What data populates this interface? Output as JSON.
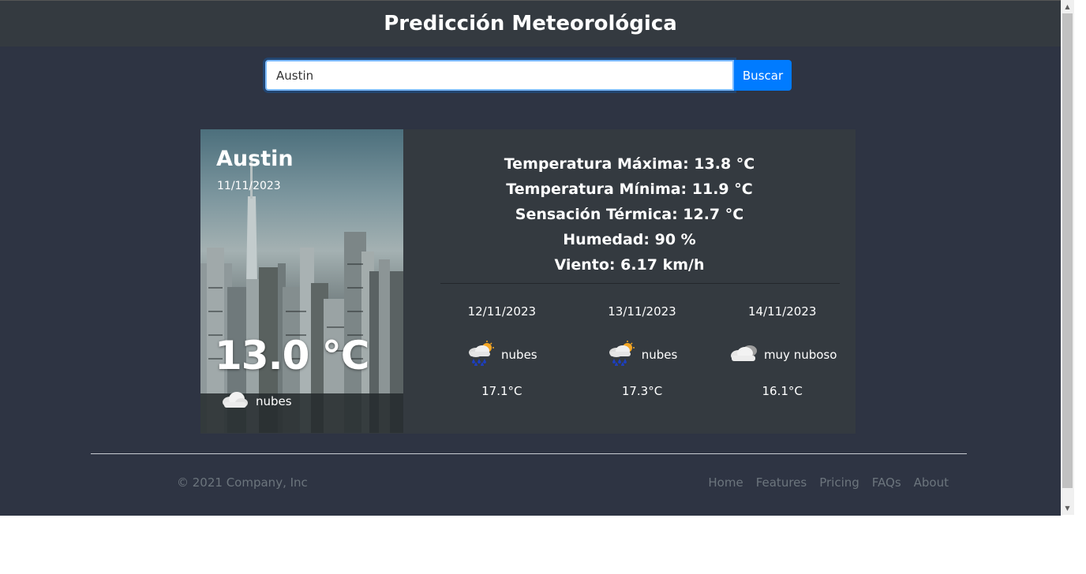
{
  "header": {
    "title": "Predicción Meteorológica"
  },
  "search": {
    "value": "Austin",
    "button_label": "Buscar"
  },
  "current": {
    "city": "Austin",
    "date": "11/11/2023",
    "temperature": "13.0 °C",
    "condition": "nubes",
    "condition_icon": "cloud-icon"
  },
  "stats": [
    {
      "text": "Temperatura Máxima: 13.8 °C"
    },
    {
      "text": "Temperatura Mínima: 11.9 °C"
    },
    {
      "text": "Sensación Térmica: 12.7 °C"
    },
    {
      "text": "Humedad: 90 %"
    },
    {
      "text": "Viento: 6.17 km/h"
    }
  ],
  "forecast": [
    {
      "date": "12/11/2023",
      "condition": "nubes",
      "icon": "rain-sun-icon",
      "temp": "17.1°C"
    },
    {
      "date": "13/11/2023",
      "condition": "nubes",
      "icon": "rain-sun-icon",
      "temp": "17.3°C"
    },
    {
      "date": "14/11/2023",
      "condition": "muy nuboso",
      "icon": "cloud-icon",
      "temp": "16.1°C"
    }
  ],
  "footer": {
    "copyright": "© 2021 Company, Inc",
    "links": [
      "Home",
      "Features",
      "Pricing",
      "FAQs",
      "About"
    ]
  },
  "colors": {
    "background": "#2e3443",
    "header": "#343a40",
    "card": "#343a40",
    "accent": "#007bff",
    "muted": "#6c757d"
  }
}
